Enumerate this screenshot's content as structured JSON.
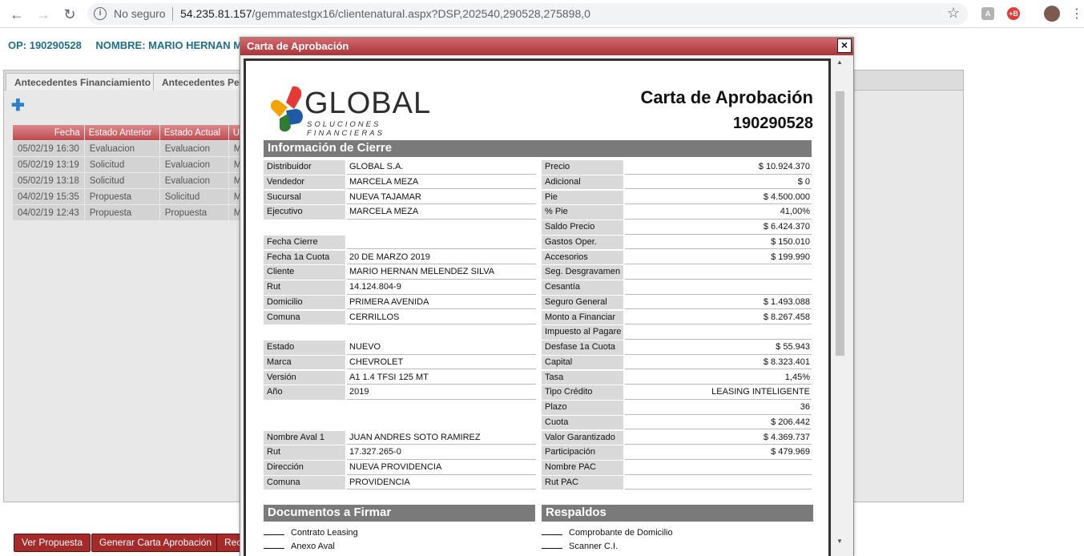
{
  "browser": {
    "security_label": "No seguro",
    "url_host": "54.235.81.157",
    "url_path": "/gemmatestgx16/clientenatural.aspx?DSP,202540,290528,275898,0"
  },
  "header": {
    "op": "OP: 190290528",
    "nombre": "NOMBRE: MARIO HERNAN ME"
  },
  "tabs": [
    "Antecedentes Financiamiento",
    "Antecedentes Per"
  ],
  "history": {
    "columns": [
      "Fecha",
      "Estado Anterior",
      "Estado Actual",
      "Us"
    ],
    "rows": [
      [
        "05/02/19 16:30",
        "Evaluacion",
        "Evaluacion",
        "MA"
      ],
      [
        "05/02/19 13:19",
        "Solicitud",
        "Evaluacion",
        "MA"
      ],
      [
        "05/02/19 13:18",
        "Solicitud",
        "Evaluacion",
        "MA"
      ],
      [
        "04/02/19 15:35",
        "Propuesta",
        "Solicitud",
        "MA"
      ],
      [
        "04/02/19 12:43",
        "Propuesta",
        "Propuesta",
        "MA"
      ]
    ]
  },
  "buttons": {
    "ver": "Ver Propuesta",
    "generar": "Generar Carta Aprobación",
    "rec": "Rec"
  },
  "modal": {
    "title": "Carta de Aprobación",
    "close": "×"
  },
  "doc": {
    "logo_word": "GLOBAL",
    "logo_sub": "SOLUCIONES FINANCIERAS",
    "title": "Carta de Aprobación",
    "number": "190290528",
    "section_info": "Información de Cierre",
    "left": [
      {
        "k": "Distribuidor",
        "v": "GLOBAL S.A."
      },
      {
        "k": "Vendedor",
        "v": "MARCELA MEZA"
      },
      {
        "k": "Sucursal",
        "v": "NUEVA TAJAMAR"
      },
      {
        "k": "Ejecutivo",
        "v": "MARCELA MEZA"
      },
      {
        "k": "",
        "v": ""
      },
      {
        "k": "Fecha Cierre",
        "v": ""
      },
      {
        "k": "Fecha 1a Cuota",
        "v": "20 DE MARZO 2019"
      },
      {
        "k": "Cliente",
        "v": "MARIO HERNAN MELENDEZ SILVA"
      },
      {
        "k": "Rut",
        "v": "14.124.804-9"
      },
      {
        "k": "Domicilio",
        "v": "PRIMERA AVENIDA"
      },
      {
        "k": "Comuna",
        "v": "CERRILLOS"
      },
      {
        "k": "",
        "v": ""
      },
      {
        "k": "Estado",
        "v": "NUEVO"
      },
      {
        "k": "Marca",
        "v": "CHEVROLET"
      },
      {
        "k": "Versión",
        "v": "A1 1.4 TFSI 125 MT"
      },
      {
        "k": "Año",
        "v": "2019"
      },
      {
        "k": "",
        "v": ""
      },
      {
        "k": "",
        "v": ""
      },
      {
        "k": "Nombre Aval 1",
        "v": "JUAN ANDRES SOTO RAMIREZ"
      },
      {
        "k": "Rut",
        "v": "17.327.265-0"
      },
      {
        "k": "Dirección",
        "v": "NUEVA PROVIDENCIA"
      },
      {
        "k": "Comuna",
        "v": "PROVIDENCIA"
      }
    ],
    "right": [
      {
        "k": "Precio",
        "v": "$ 10.924.370"
      },
      {
        "k": "Adicional",
        "v": "$ 0"
      },
      {
        "k": "Pie",
        "v": "$ 4.500.000"
      },
      {
        "k": "% Pie",
        "v": "41,00%"
      },
      {
        "k": "Saldo Precio",
        "v": "$ 6.424.370"
      },
      {
        "k": "Gastos Oper.",
        "v": "$ 150.010"
      },
      {
        "k": "Accesorios",
        "v": "$ 199.990"
      },
      {
        "k": "Seg. Desgravamen",
        "v": ""
      },
      {
        "k": "Cesantía",
        "v": ""
      },
      {
        "k": "Seguro General",
        "v": "$ 1.493.088"
      },
      {
        "k": "Monto a Financiar",
        "v": "$ 8.267.458"
      },
      {
        "k": "Impuesto al Pagare",
        "v": ""
      },
      {
        "k": "Desfase 1a Cuota",
        "v": "$ 55.943"
      },
      {
        "k": "Capital",
        "v": "$ 8.323.401"
      },
      {
        "k": "Tasa",
        "v": "1,45%"
      },
      {
        "k": "Tipo Crédito",
        "v": "LEASING INTELIGENTE"
      },
      {
        "k": "Plazo",
        "v": "36"
      },
      {
        "k": "Cuota",
        "v": "$ 206.442"
      },
      {
        "k": "Valor Garantizado",
        "v": "$ 4.369.737"
      },
      {
        "k": "Participación",
        "v": "$ 479.969"
      },
      {
        "k": "Nombre PAC",
        "v": ""
      },
      {
        "k": "Rut PAC",
        "v": ""
      }
    ],
    "section_docs": "Documentos a Firmar",
    "section_resp": "Respaldos",
    "docs": [
      "Contrato Leasing",
      "Anexo Aval"
    ],
    "resp": [
      "Comprobante de Domicilio",
      "Scanner C.I."
    ]
  }
}
